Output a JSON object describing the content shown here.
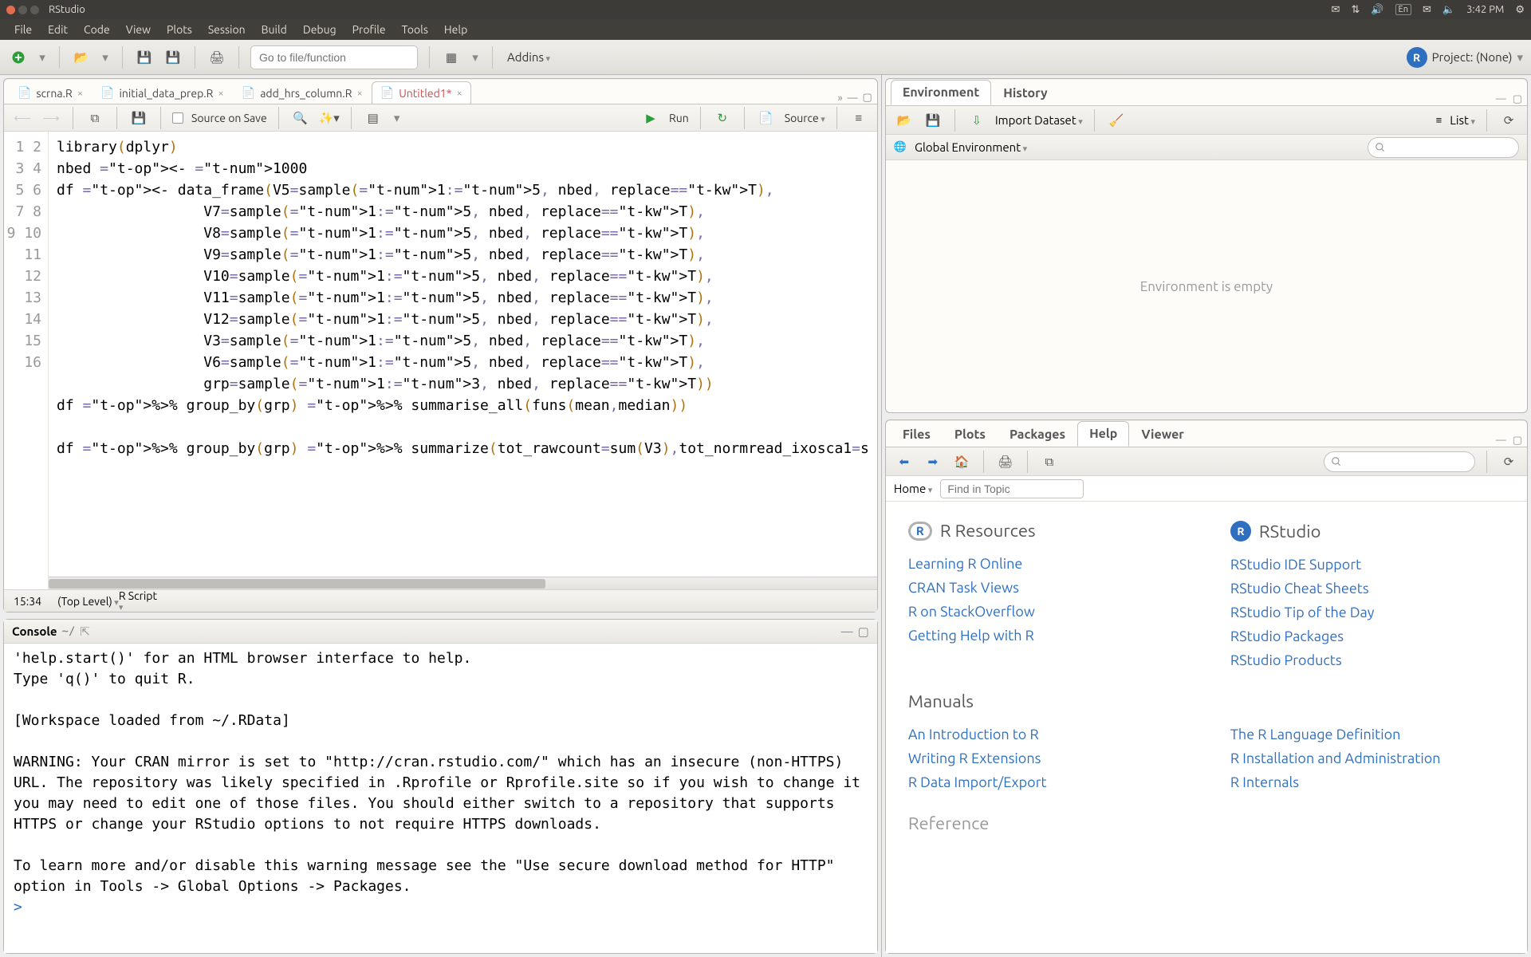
{
  "os": {
    "app_title": "RStudio",
    "indicators": {
      "lang": "En",
      "clock": "3:42 PM"
    }
  },
  "menubar": [
    "File",
    "Edit",
    "Code",
    "View",
    "Plots",
    "Session",
    "Build",
    "Debug",
    "Profile",
    "Tools",
    "Help"
  ],
  "maintoolbar": {
    "goto_placeholder": "Go to file/function",
    "addins_label": "Addins",
    "project_label": "Project: (None)"
  },
  "source": {
    "tabs": [
      {
        "label": "scrna.R",
        "dirty": false,
        "active": false
      },
      {
        "label": "initial_data_prep.R",
        "dirty": false,
        "active": false
      },
      {
        "label": "add_hrs_column.R",
        "dirty": false,
        "active": false
      },
      {
        "label": "Untitled1*",
        "dirty": true,
        "active": true
      }
    ],
    "toolbar": {
      "source_on_save": "Source on Save",
      "run": "Run",
      "source": "Source"
    },
    "status": {
      "cursor": "15:34",
      "scope": "(Top Level)",
      "type": "R Script"
    },
    "code_lines": [
      "library(dplyr)",
      "nbed <- 1000",
      "df <- data_frame(V5=sample(1:5, nbed, replace=T),",
      "                 V7=sample(1:5, nbed, replace=T),",
      "                 V8=sample(1:5, nbed, replace=T),",
      "                 V9=sample(1:5, nbed, replace=T),",
      "                 V10=sample(1:5, nbed, replace=T),",
      "                 V11=sample(1:5, nbed, replace=T),",
      "                 V12=sample(1:5, nbed, replace=T),",
      "                 V3=sample(1:5, nbed, replace=T),",
      "                 V6=sample(1:5, nbed, replace=T),",
      "                 grp=sample(1:3, nbed, replace=T))",
      "df %>% group_by(grp) %>% summarise_all(funs(mean,median))",
      "",
      "df %>% group_by(grp) %>% summarize(tot_rawcount=sum(V3),tot_normread_ixosca1=s",
      ""
    ]
  },
  "console": {
    "title": "Console",
    "cwd": "~/",
    "text": "'help.start()' for an HTML browser interface to help.\nType 'q()' to quit R.\n\n[Workspace loaded from ~/.RData]\n\nWARNING: Your CRAN mirror is set to \"http://cran.rstudio.com/\" which has an insecure (non-HTTPS) URL. The repository was likely specified in .Rprofile or Rprofile.site so if you wish to change it you may need to edit one of those files. You should either switch to a repository that supports HTTPS or change your RStudio options to not require HTTPS downloads.\n\nTo learn more and/or disable this warning message see the \"Use secure download method for HTTP\" option in Tools -> Global Options -> Packages.",
    "prompt": ">"
  },
  "environment": {
    "tabs": [
      "Environment",
      "History"
    ],
    "active_tab": "Environment",
    "import_label": "Import Dataset",
    "view_label": "List",
    "scope": "Global Environment",
    "empty_msg": "Environment is empty"
  },
  "bottom_right": {
    "tabs": [
      "Files",
      "Plots",
      "Packages",
      "Help",
      "Viewer"
    ],
    "active_tab": "Help",
    "home_label": "Home",
    "find_placeholder": "Find in Topic",
    "search_placeholder": "",
    "help": {
      "sections": [
        {
          "heading": "R Resources",
          "col1": [
            "Learning R Online",
            "CRAN Task Views",
            "R on StackOverflow",
            "Getting Help with R"
          ],
          "rs_heading": "RStudio",
          "col2": [
            "RStudio IDE Support",
            "RStudio Cheat Sheets",
            "RStudio Tip of the Day",
            "RStudio Packages",
            "RStudio Products"
          ]
        },
        {
          "heading": "Manuals",
          "col1": [
            "An Introduction to R",
            "Writing R Extensions",
            "R Data Import/Export"
          ],
          "col2": [
            "The R Language Definition",
            "R Installation and Administration",
            "R Internals"
          ]
        },
        {
          "heading": "Reference"
        }
      ]
    }
  }
}
